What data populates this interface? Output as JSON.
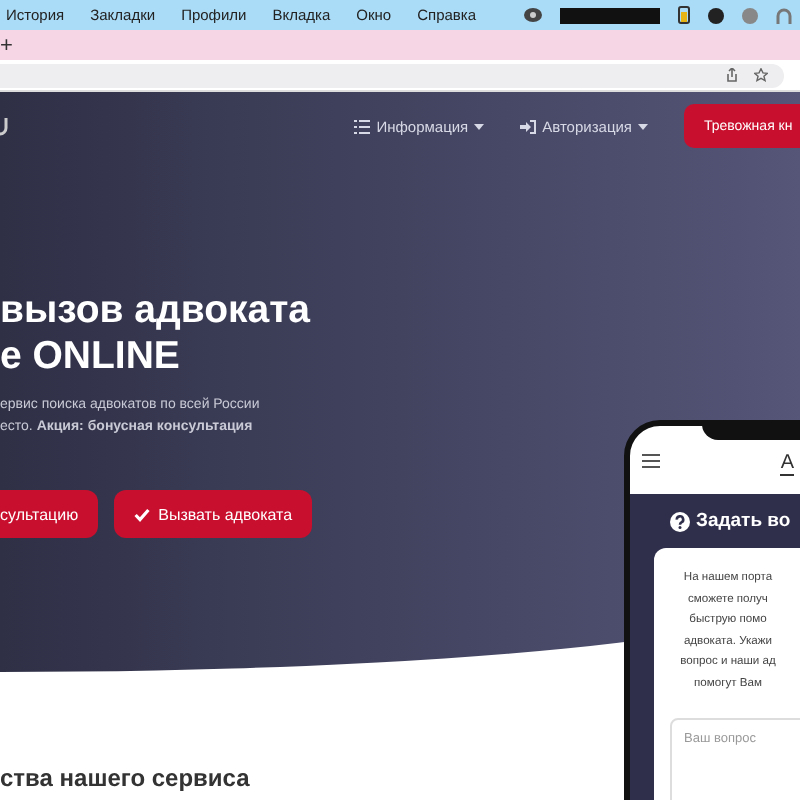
{
  "menu_bar": {
    "items": [
      "История",
      "Закладки",
      "Профили",
      "Вкладка",
      "Окно",
      "Справка"
    ]
  },
  "tab_strip": {
    "new_tab": "+"
  },
  "nav": {
    "items": [
      {
        "label": "Информация"
      },
      {
        "label": "Авторизация"
      }
    ],
    "alarm_button": "Тревожная кн"
  },
  "hero": {
    "title_lines": [
      "вызов адвоката",
      "е ONLINE"
    ],
    "subtitle_lines": [
      "ервис поиска адвокатов по всей России",
      "есто. **Акция: бонусная консультация**"
    ],
    "buttons": [
      {
        "label": "сультацию"
      },
      {
        "label": "Вызвать адвоката"
      }
    ]
  },
  "section_title": "ства нашего сервиса",
  "phone": {
    "logo": "А",
    "form_title": "Задать во",
    "intro_lines": [
      "На нашем порта",
      "сможете получ",
      "быструю помо",
      "адвоката. Укажи",
      "вопрос и наши ад",
      "помогут Вам"
    ],
    "question_placeholder": "Ваш вопрос"
  }
}
